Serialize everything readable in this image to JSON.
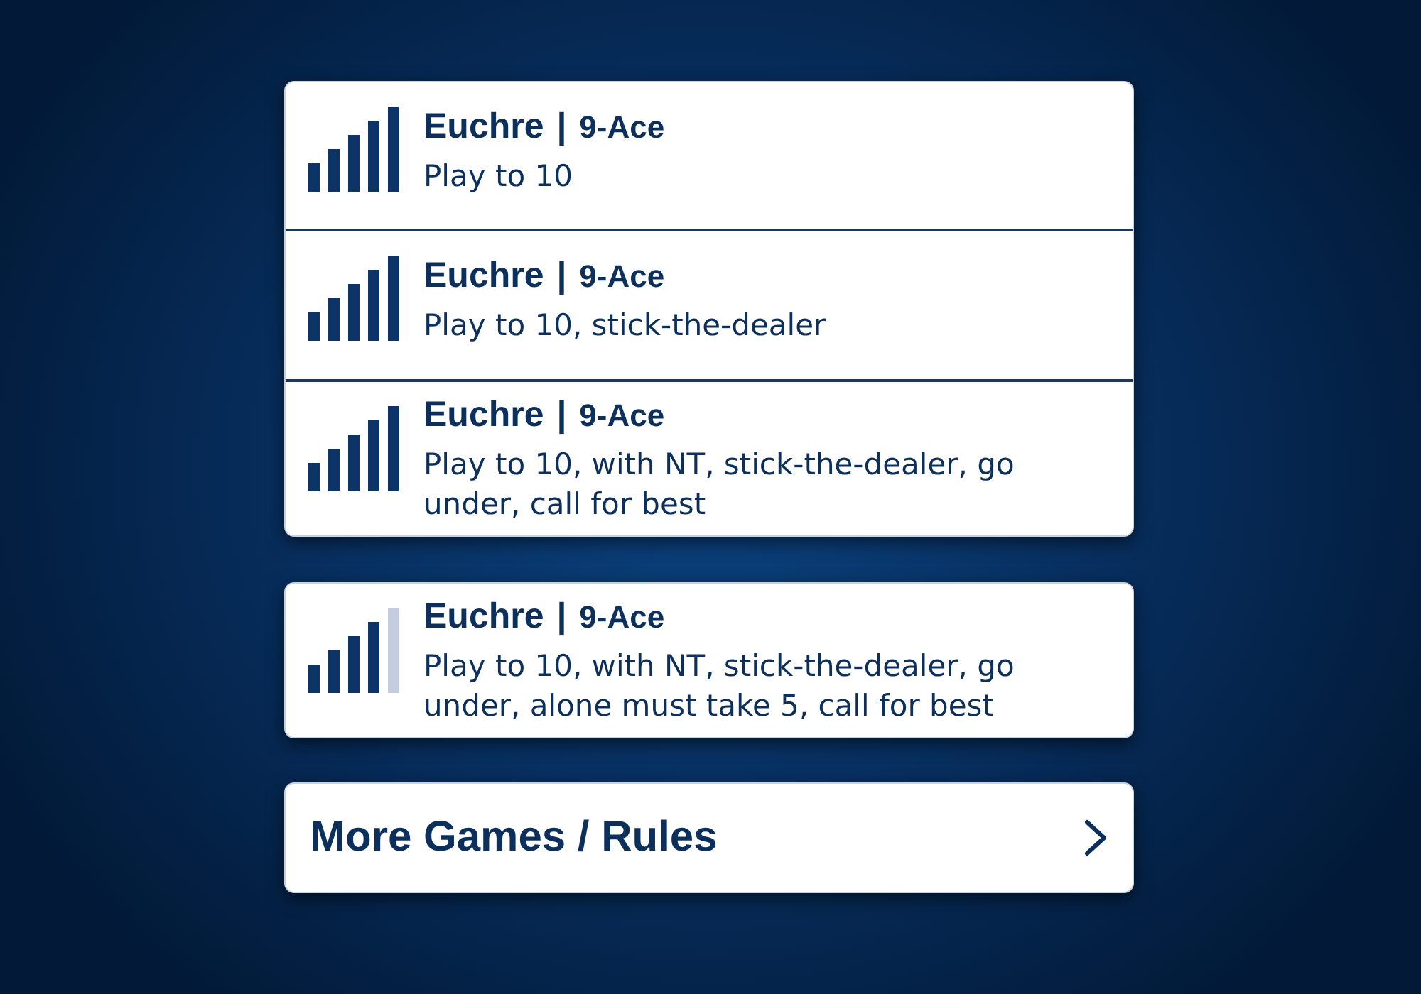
{
  "groups": [
    {
      "games": [
        {
          "name": "Euchre",
          "separator": "|",
          "variant": "9-Ace",
          "rules": "Play to 10",
          "bars": [
            {
              "filled": true
            },
            {
              "filled": true
            },
            {
              "filled": true
            },
            {
              "filled": true
            },
            {
              "filled": true
            }
          ]
        },
        {
          "name": "Euchre",
          "separator": "|",
          "variant": "9-Ace",
          "rules": "Play to 10, stick-the-dealer",
          "bars": [
            {
              "filled": true
            },
            {
              "filled": true
            },
            {
              "filled": true
            },
            {
              "filled": true
            },
            {
              "filled": true
            }
          ]
        },
        {
          "name": "Euchre",
          "separator": "|",
          "variant": "9-Ace",
          "rules": "Play to 10, with NT, stick-the-dealer, go under, call for best",
          "bars": [
            {
              "filled": true
            },
            {
              "filled": true
            },
            {
              "filled": true
            },
            {
              "filled": true
            },
            {
              "filled": true
            }
          ]
        }
      ]
    },
    {
      "games": [
        {
          "name": "Euchre",
          "separator": "|",
          "variant": "9-Ace",
          "rules": "Play to 10, with NT, stick-the-dealer, go under, alone must take 5, call for best",
          "bars": [
            {
              "filled": true
            },
            {
              "filled": true
            },
            {
              "filled": true
            },
            {
              "filled": true
            },
            {
              "filled": false
            }
          ]
        }
      ]
    }
  ],
  "more_button": {
    "label": "More Games / Rules"
  }
}
